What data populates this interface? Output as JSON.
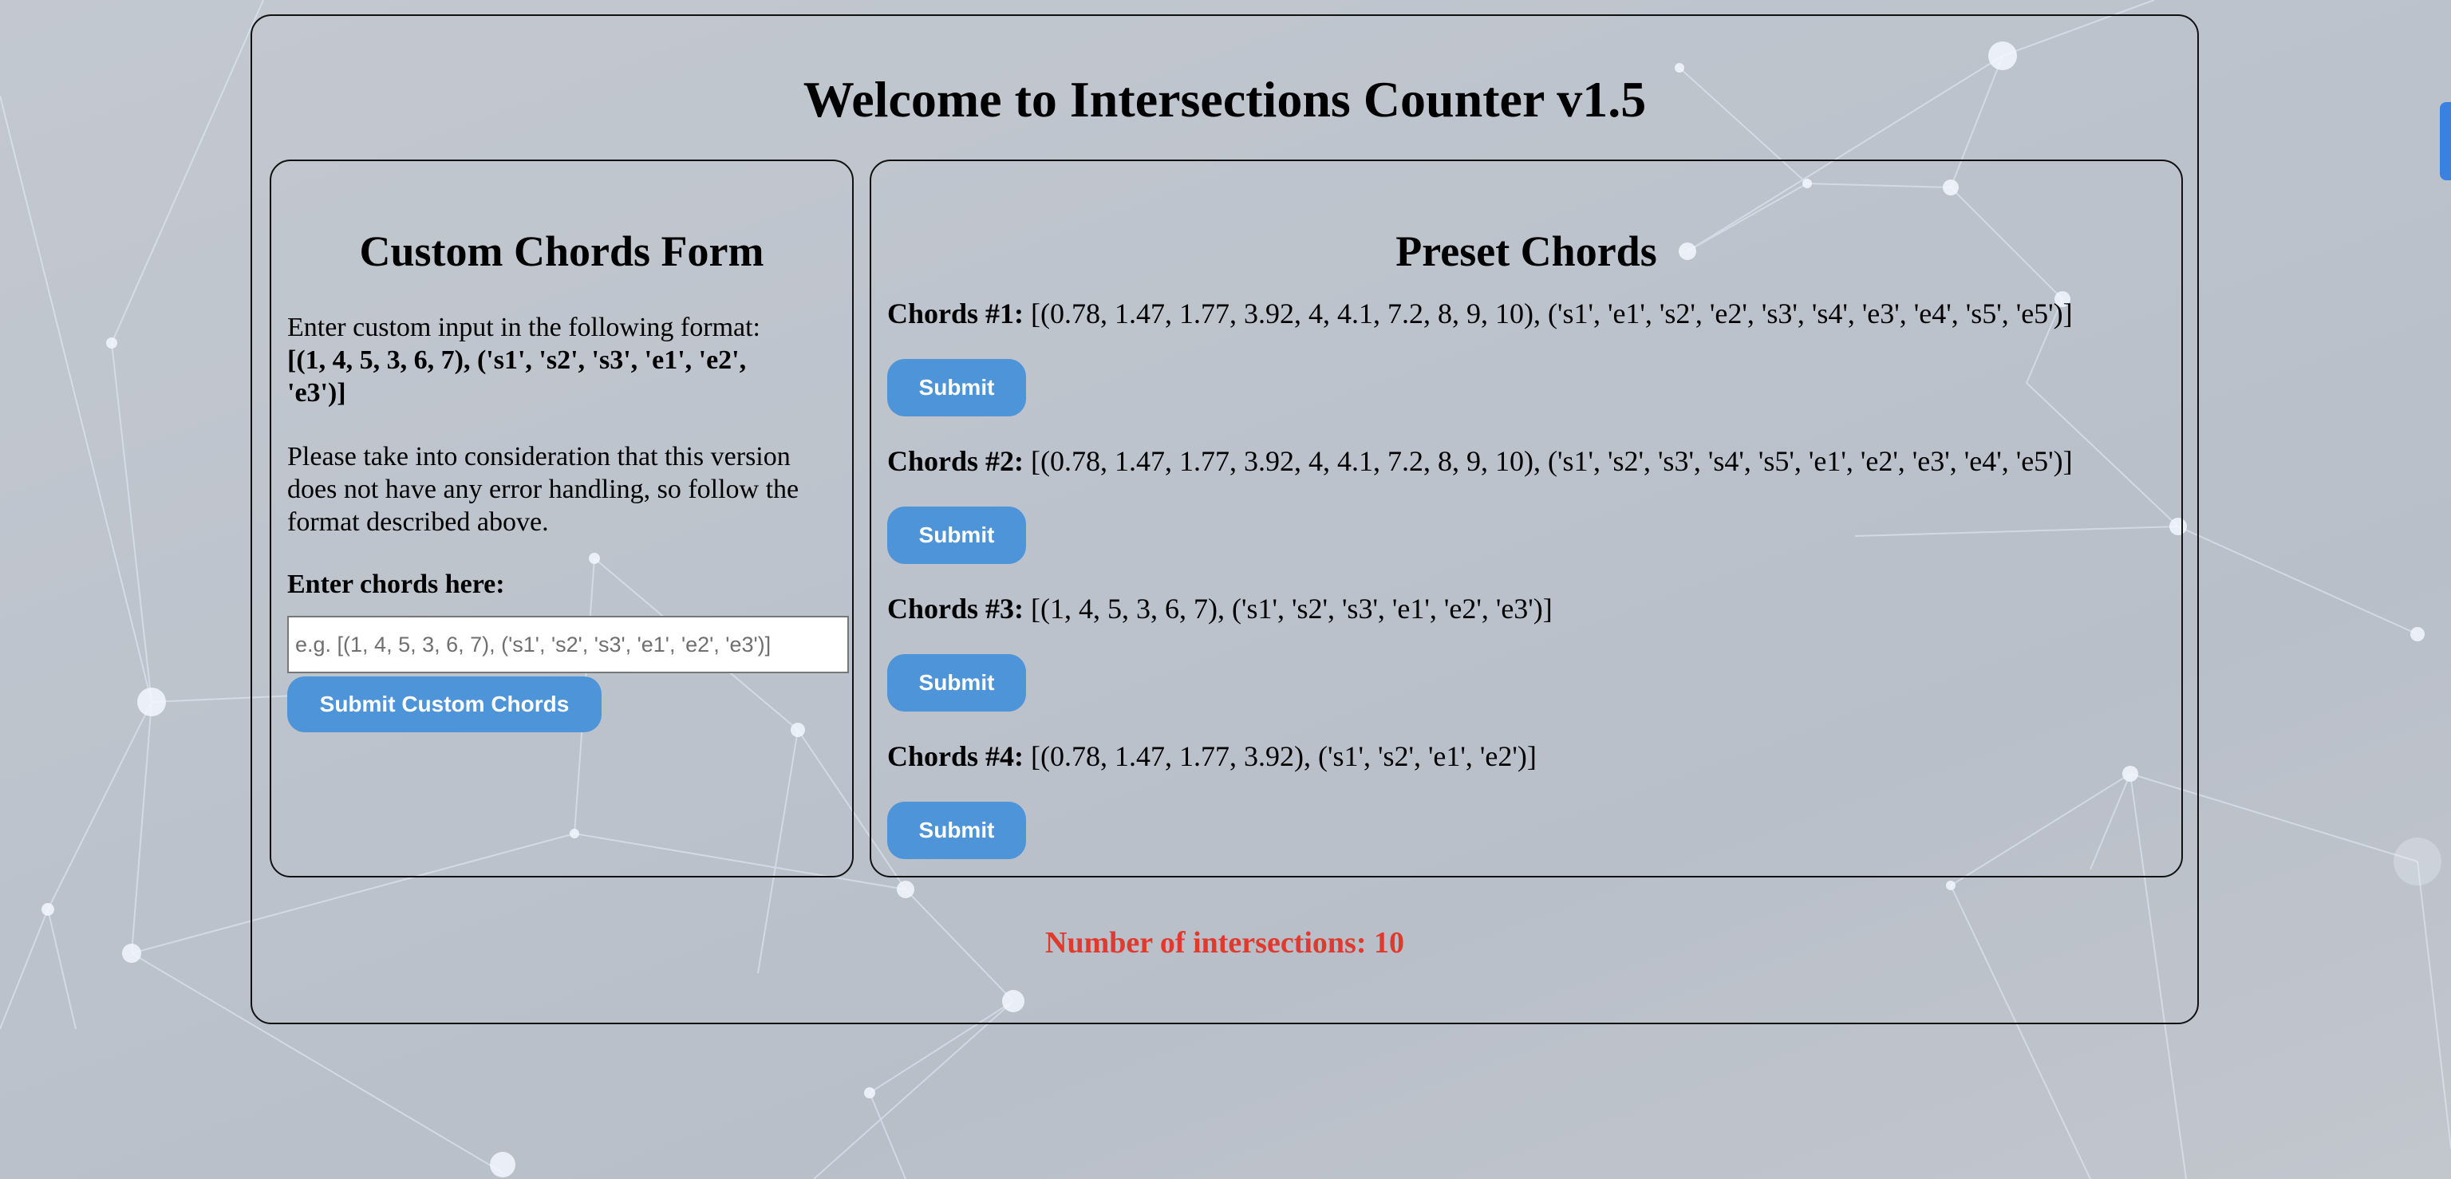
{
  "app": {
    "title": "Welcome to Intersections Counter v1.5"
  },
  "custom_form": {
    "heading": "Custom Chords Form",
    "instruction": "Enter custom input in the following format:",
    "format_example": "[(1, 4, 5, 3, 6, 7), ('s1', 's2', 's3', 'e1', 'e2', 'e3')]",
    "note": "Please take into consideration that this version does not have any error handling, so follow the format described above.",
    "input_label": "Enter chords here:",
    "input_placeholder": "e.g. [(1, 4, 5, 3, 6, 7), ('s1', 's2', 's3', 'e1', 'e2', 'e3')]",
    "input_value": "",
    "submit_label": "Submit Custom Chords"
  },
  "preset": {
    "heading": "Preset Chords",
    "items": [
      {
        "label": "Chords #1:",
        "value": "[(0.78, 1.47, 1.77, 3.92, 4, 4.1, 7.2, 8, 9, 10), ('s1', 'e1', 's2', 'e2', 's3', 's4', 'e3', 'e4', 's5', 'e5')]",
        "button": "Submit"
      },
      {
        "label": "Chords #2:",
        "value": "[(0.78, 1.47, 1.77, 3.92, 4, 4.1, 7.2, 8, 9, 10), ('s1', 's2', 's3', 's4', 's5', 'e1', 'e2', 'e3', 'e4', 'e5')]",
        "button": "Submit"
      },
      {
        "label": "Chords #3:",
        "value": "[(1, 4, 5, 3, 6, 7), ('s1', 's2', 's3', 'e1', 'e2', 'e3')]",
        "button": "Submit"
      },
      {
        "label": "Chords #4:",
        "value": "[(0.78, 1.47, 1.77, 3.92), ('s1', 's2', 'e1', 'e2')]",
        "button": "Submit"
      }
    ]
  },
  "result": {
    "text": "Number of intersections: 10"
  },
  "colors": {
    "button": "#4d94d8",
    "result_text": "#e03a2e",
    "background": "#bdc3cc"
  }
}
